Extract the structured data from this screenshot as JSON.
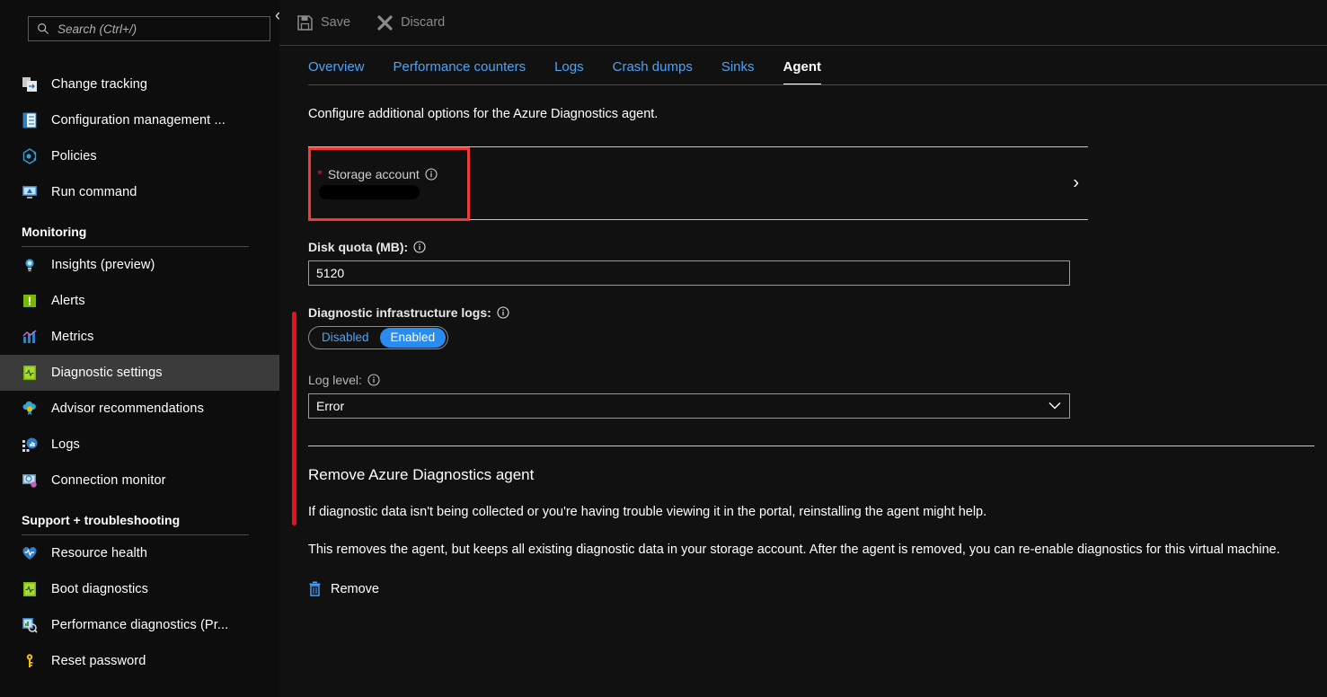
{
  "sidebar": {
    "search": {
      "placeholder": "Search (Ctrl+/)",
      "value": "",
      "icon": "search-icon"
    },
    "collapse_icon": "chevron-double-left-icon",
    "items": [
      {
        "label": "Change tracking",
        "icon": "change-tracking-icon",
        "selected": false
      },
      {
        "label": "Configuration management ...",
        "icon": "configuration-management-icon",
        "selected": false
      },
      {
        "label": "Policies",
        "icon": "policies-icon",
        "selected": false
      },
      {
        "label": "Run command",
        "icon": "run-command-icon",
        "selected": false
      }
    ],
    "groups": [
      {
        "title": "Monitoring",
        "items": [
          {
            "label": "Insights (preview)",
            "icon": "insights-icon",
            "selected": false
          },
          {
            "label": "Alerts",
            "icon": "alerts-icon",
            "selected": false
          },
          {
            "label": "Metrics",
            "icon": "metrics-icon",
            "selected": false
          },
          {
            "label": "Diagnostic settings",
            "icon": "diagnostic-settings-icon",
            "selected": true
          },
          {
            "label": "Advisor recommendations",
            "icon": "advisor-icon",
            "selected": false
          },
          {
            "label": "Logs",
            "icon": "logs-icon",
            "selected": false
          },
          {
            "label": "Connection monitor",
            "icon": "connection-monitor-icon",
            "selected": false
          }
        ]
      },
      {
        "title": "Support + troubleshooting",
        "items": [
          {
            "label": "Resource health",
            "icon": "resource-health-icon",
            "selected": false
          },
          {
            "label": "Boot diagnostics",
            "icon": "boot-diagnostics-icon",
            "selected": false
          },
          {
            "label": "Performance diagnostics (Pr...",
            "icon": "performance-diagnostics-icon",
            "selected": false
          },
          {
            "label": "Reset password",
            "icon": "reset-password-icon",
            "selected": false
          }
        ]
      }
    ]
  },
  "toolbar": {
    "save_label": "Save",
    "save_icon": "save-icon",
    "discard_label": "Discard",
    "discard_icon": "discard-x-icon",
    "enabled": false
  },
  "tabs": [
    {
      "label": "Overview",
      "active": false
    },
    {
      "label": "Performance counters",
      "active": false
    },
    {
      "label": "Logs",
      "active": false
    },
    {
      "label": "Crash dumps",
      "active": false
    },
    {
      "label": "Sinks",
      "active": false
    },
    {
      "label": "Agent",
      "active": true
    }
  ],
  "main": {
    "intro": "Configure additional options for the Azure Diagnostics agent.",
    "storage_account": {
      "label": "Storage account",
      "required_marker": "*",
      "info_icon": "info-icon",
      "value": "",
      "value_redacted": true,
      "chevron_icon": "chevron-right-icon",
      "highlighted": true,
      "highlight_color": "#f03a3a"
    },
    "disk_quota": {
      "label": "Disk quota (MB):",
      "info_icon": "info-icon",
      "value": "5120"
    },
    "diagnostic_infrastructure_logs": {
      "label": "Diagnostic infrastructure logs:",
      "info_icon": "info-icon",
      "options": [
        "Disabled",
        "Enabled"
      ],
      "selected": "Enabled"
    },
    "log_level": {
      "label": "Log level:",
      "info_icon": "info-icon",
      "value": "Error",
      "chevron_icon": "chevron-down-icon"
    },
    "removal": {
      "title": "Remove Azure Diagnostics agent",
      "paragraph1": "If diagnostic data isn't being collected or you're having trouble viewing it in the portal, reinstalling the agent might help.",
      "paragraph2": "This removes the agent, but keeps all existing diagnostic data in your storage account. After the agent is removed, you can re-enable diagnostics for this virtual machine.",
      "remove_label": "Remove",
      "remove_icon": "trash-icon"
    }
  },
  "colors": {
    "background": "#111111",
    "sidebar_background": "#0d0d0d",
    "accent_link": "#4ea3f5",
    "toggle_on": "#2b8cf0",
    "required_red": "#e81123",
    "highlight_red": "#f03a3a"
  }
}
